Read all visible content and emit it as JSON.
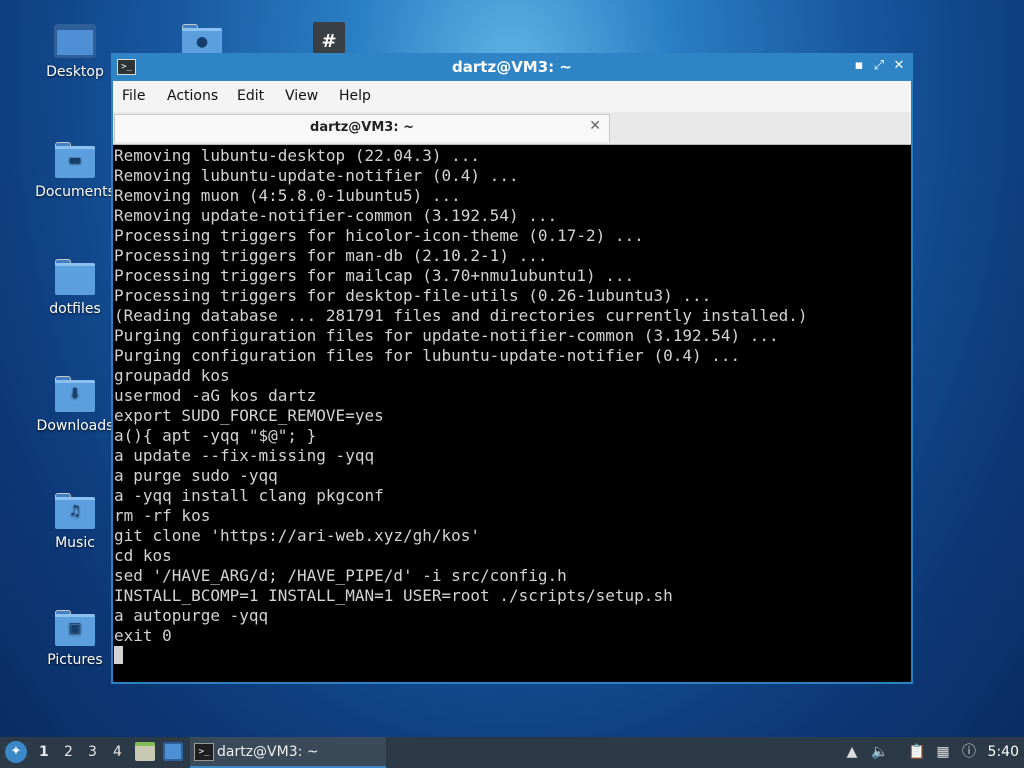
{
  "desktop": {
    "icons": [
      {
        "label": "Desktop"
      },
      {
        "label": "Documents"
      },
      {
        "label": "dotfiles"
      },
      {
        "label": "Downloads"
      },
      {
        "label": "Music"
      },
      {
        "label": "Pictures"
      }
    ]
  },
  "window": {
    "title": "dartz@VM3: ~",
    "icon_glyph": ">_",
    "controls": {
      "minimize": "▪",
      "maximize": "⤢",
      "close": "✕"
    },
    "menu": [
      "File",
      "Actions",
      "Edit",
      "View",
      "Help"
    ],
    "tab": {
      "label": "dartz@VM3: ~",
      "close": "✕"
    },
    "terminal_lines": [
      "Removing lubuntu-desktop (22.04.3) ...",
      "Removing lubuntu-update-notifier (0.4) ...",
      "Removing muon (4:5.8.0-1ubuntu5) ...",
      "Removing update-notifier-common (3.192.54) ...",
      "Processing triggers for hicolor-icon-theme (0.17-2) ...",
      "Processing triggers for man-db (2.10.2-1) ...",
      "Processing triggers for mailcap (3.70+nmu1ubuntu1) ...",
      "Processing triggers for desktop-file-utils (0.26-1ubuntu3) ...",
      "(Reading database ... 281791 files and directories currently installed.)",
      "Purging configuration files for update-notifier-common (3.192.54) ...",
      "Purging configuration files for lubuntu-update-notifier (0.4) ...",
      "groupadd kos",
      "usermod -aG kos dartz",
      "export SUDO_FORCE_REMOVE=yes",
      "a(){ apt -yqq \"$@\"; }",
      "a update --fix-missing -yqq",
      "a purge sudo -yqq",
      "a -yqq install clang pkgconf",
      "rm -rf kos",
      "git clone 'https://ari-web.xyz/gh/kos'",
      "cd kos",
      "sed '/HAVE_ARG/d; /HAVE_PIPE/d' -i src/config.h",
      "INSTALL_BCOMP=1 INSTALL_MAN=1 USER=root ./scripts/setup.sh",
      "a autopurge -yqq",
      "exit 0"
    ]
  },
  "taskbar": {
    "workspaces": [
      "1",
      "2",
      "3",
      "4"
    ],
    "active_workspace": "1",
    "task_label": "dartz@VM3: ~",
    "clock": "5:40"
  },
  "colors": {
    "accent": "#2f84c6",
    "terminal_bg": "#000000",
    "terminal_fg": "#d3d3d3",
    "taskbar_bg": "#2c3a47"
  }
}
